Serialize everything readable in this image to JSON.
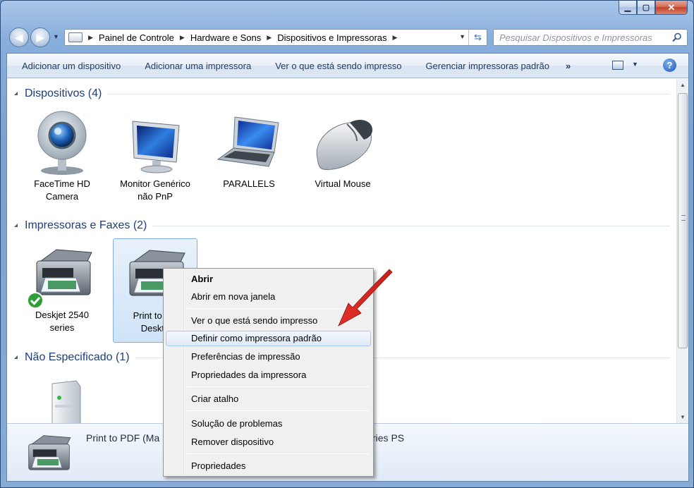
{
  "window": {
    "caption_buttons": {
      "minimize": "▁",
      "maximize": "▢",
      "close": "✕"
    }
  },
  "navigation": {
    "back_icon": "back-arrow-icon",
    "forward_icon": "forward-arrow-icon",
    "breadcrumbs": [
      "Painel de Controle",
      "Hardware e Sons",
      "Dispositivos e Impressoras"
    ],
    "search_placeholder": "Pesquisar Dispositivos e Impressoras"
  },
  "toolbar": {
    "items": [
      "Adicionar um dispositivo",
      "Adicionar uma impressora",
      "Ver o que está sendo impresso",
      "Gerenciar impressoras padrão"
    ],
    "more": "»",
    "help": "?"
  },
  "groups": {
    "devices": {
      "title": "Dispositivos (4)",
      "items": [
        {
          "label": "FaceTime HD\nCamera",
          "line1": "FaceTime HD",
          "line2": "Camera",
          "icon": "webcam-icon"
        },
        {
          "label": "Monitor Genérico não PnP",
          "line1": "Monitor Genérico",
          "line2": "não PnP",
          "icon": "monitor-icon"
        },
        {
          "label": "PARALLELS",
          "line1": "PARALLELS",
          "line2": "",
          "icon": "laptop-icon"
        },
        {
          "label": "Virtual Mouse",
          "line1": "Virtual Mouse",
          "line2": "",
          "icon": "mouse-icon"
        }
      ]
    },
    "printers": {
      "title": "Impressoras e Faxes (2)",
      "items": [
        {
          "line1": "Deskjet 2540",
          "line2": "series",
          "icon": "printer-icon",
          "default": true
        },
        {
          "line1": "Print to PD",
          "line2": "Deskto",
          "icon": "printer-icon",
          "selected": true
        }
      ]
    },
    "unspecified": {
      "title": "Não Especificado (1)",
      "items": [
        {
          "icon": "computer-tower-icon"
        }
      ]
    }
  },
  "details": {
    "name": "Print to PDF (Ma",
    "tail": "ries PS"
  },
  "context_menu": {
    "items": [
      {
        "label": "Abrir",
        "bold": true
      },
      {
        "label": "Abrir em nova janela"
      },
      {
        "label": "Ver o que está sendo impresso"
      },
      {
        "label": "Definir como impressora padrão",
        "hover": true
      },
      {
        "label": "Preferências de impressão"
      },
      {
        "label": "Propriedades da impressora"
      },
      {
        "label": "Criar atalho"
      },
      {
        "label": "Solução de problemas"
      },
      {
        "label": "Remover dispositivo"
      },
      {
        "label": "Propriedades"
      }
    ]
  },
  "colors": {
    "annotation_arrow": "#d0261f",
    "group_title": "#1e3d7a",
    "menu_hover": "#dfeaf8"
  }
}
